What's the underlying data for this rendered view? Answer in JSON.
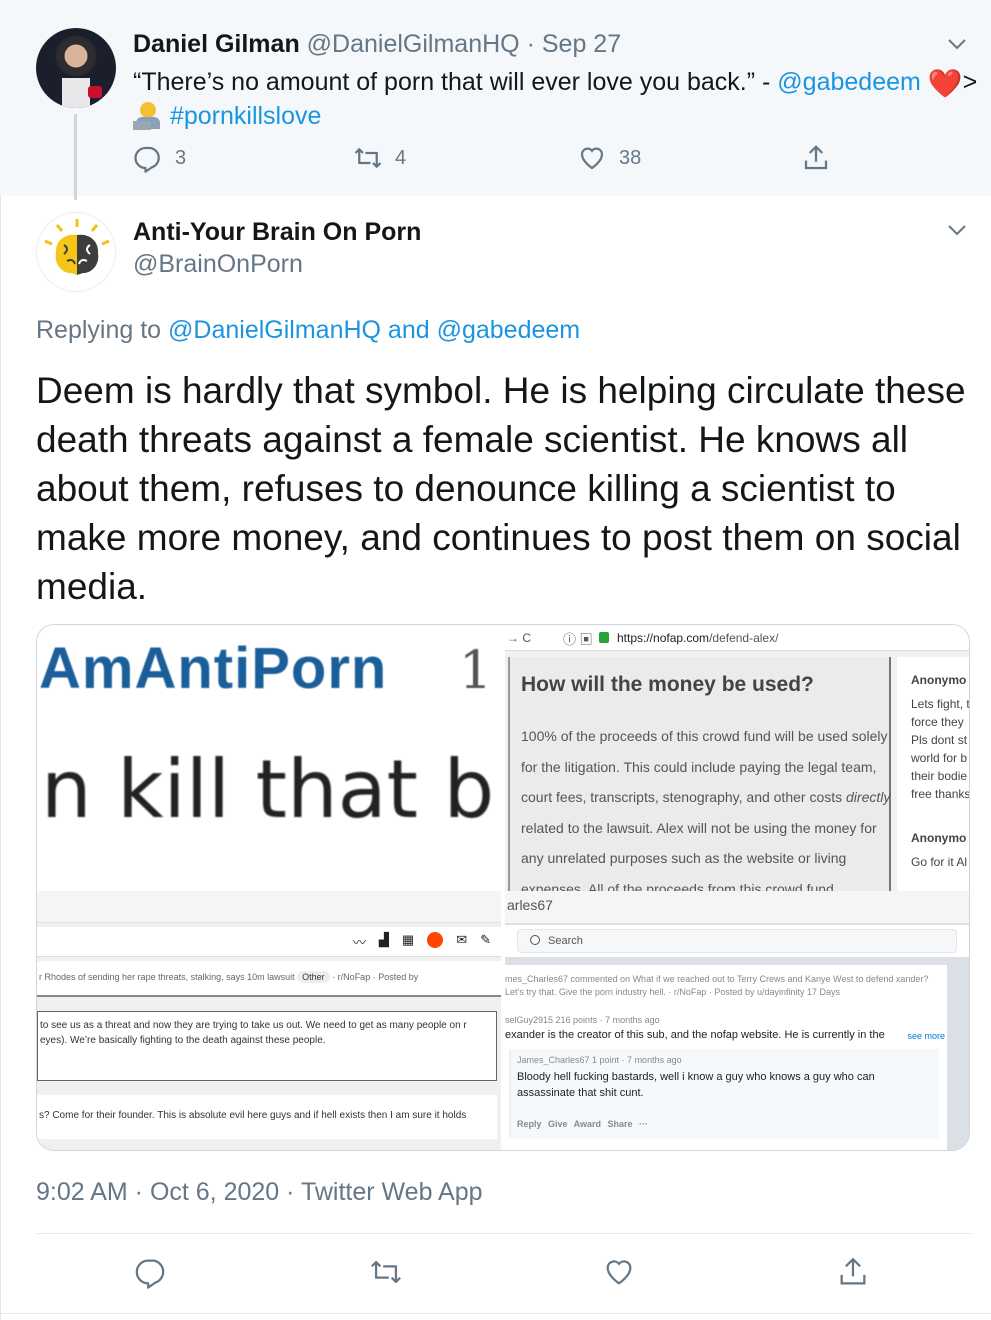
{
  "parent_tweet": {
    "name": "Daniel Gilman",
    "handle": "@DanielGilmanHQ",
    "sep": "·",
    "date": "Sep 27",
    "text_quote": "“There’s no amount of porn that will ever love you back.” - ",
    "mention": "@gabedeem",
    "heart": "❤️",
    "gt": ">",
    "hashtag": "#pornkillslove",
    "replies": "3",
    "retweets": "4",
    "likes": "38"
  },
  "main_tweet": {
    "name": "Anti-Your Brain On Porn",
    "handle": "@BrainOnPorn",
    "replying_prefix": "Replying to ",
    "replying_user1": "@DanielGilmanHQ",
    "replying_and": " and ",
    "replying_user2": "@gabedeem",
    "text": "Deem is hardly that symbol. He is helping circulate these death threats against a female scientist. He knows all about them, refuses to denounce killing a scientist to make more money, and continues to post them on social media.",
    "timestamp": "9:02 AM · Oct 6, 2020 · Twitter Web App"
  },
  "media": {
    "panel_a": {
      "line1": "AmAntiPorn",
      "num": "1",
      "line2": "n kill that b"
    },
    "panel_b": {
      "nav": "→  C",
      "url_domain": "https://nofap.com",
      "url_path": "/defend-alex/",
      "heading": "How will the money be used?",
      "para_before_italic": "100% of the proceeds of this crowd fund will be used solely for the litigation. This could include paying the legal team, court fees, transcripts, stenography, and other costs ",
      "para_italic": "directly",
      "para_after_italic": " related to the lawsuit. Alex will not be using the money for any unrelated purposes such as the website or living expenses. All of the proceeds from this crowd fund",
      "side_anon1": "Anonymo",
      "side_lines1": [
        "Lets fight, t",
        "force they",
        "Pls dont st",
        "world for b",
        "their bodie",
        "free thanks"
      ],
      "side_anon2": "Anonymo",
      "side_line2": "Go for it Al"
    },
    "panel_c": {
      "post_line": "r Rhodes of sending her rape threats, stalking, says 10m lawsuit",
      "post_tag": "Other",
      "post_sub": "· r/NoFap · Posted by",
      "comment1": "to see us as a threat and now they are trying to take us out. We need to get as many people on r eyes). We’re basically fighting to the death against these people.",
      "comment2": "s? Come for their founder. This is absolute evil here guys and if hell exists then I am sure it holds"
    },
    "panel_d": {
      "user": "arles67",
      "search": "Search",
      "feed_line": "mes_Charles67 commented on What if we reached out to Terry Crews and Kanye West to defend xander? Let’s try that. Give the porn industry hell. · r/NoFap · Posted by u/dayinfinity  17 Days",
      "meta2": "selGuy2915 216 points · 7 months ago",
      "body2": "exander is the creator of this sub, and the nofap website. He is currently in the",
      "see_more": "see more",
      "reply_hdr": "James_Charles67 1 point · 7 months ago",
      "reply_body": "Bloody hell fucking bastards, well i know a guy who knows a guy who can assassinate that shit cunt.",
      "reply_acts": "Reply  Give Award  Share  ···"
    }
  },
  "icons": {
    "reply": "reply-icon",
    "retweet": "retweet-icon",
    "like": "heart-icon",
    "share": "share-icon",
    "caret": "chevron-down-icon"
  },
  "colors": {
    "link": "#1b95e0",
    "muted": "#657786",
    "parent_bg": "#f5f8fa"
  }
}
